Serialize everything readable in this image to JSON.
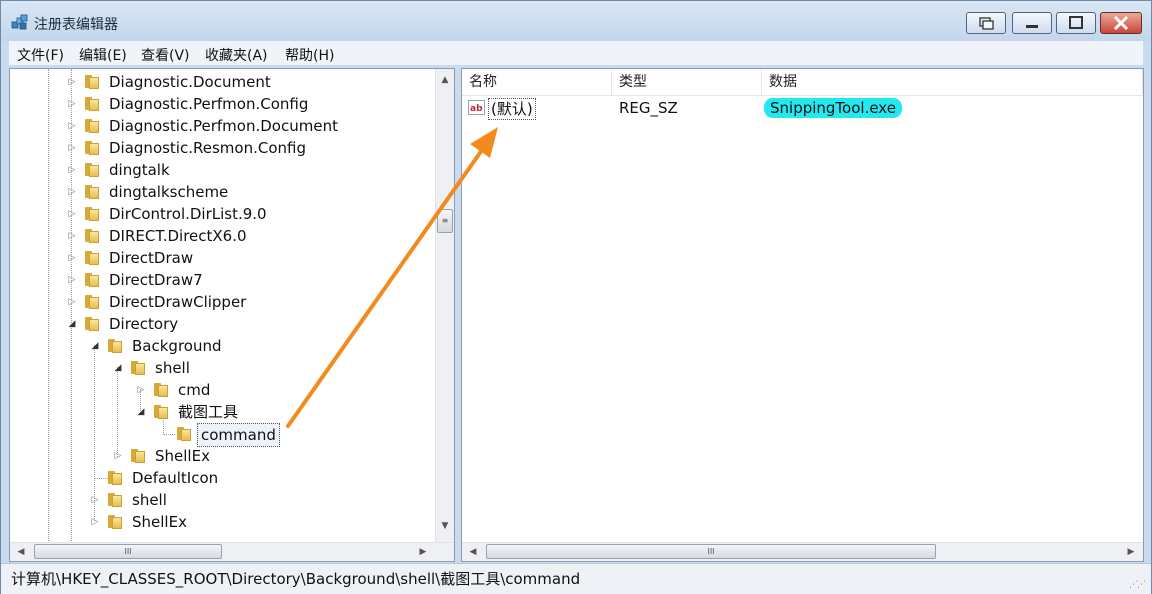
{
  "window": {
    "title": "注册表编辑器"
  },
  "menubar": {
    "items": [
      "文件(F)",
      "编辑(E)",
      "查看(V)",
      "收藏夹(A)",
      "帮助(H)"
    ]
  },
  "tree": {
    "items": [
      {
        "label": "Diagnostic.Document",
        "state": "collapsed"
      },
      {
        "label": "Diagnostic.Perfmon.Config",
        "state": "collapsed"
      },
      {
        "label": "Diagnostic.Perfmon.Document",
        "state": "collapsed"
      },
      {
        "label": "Diagnostic.Resmon.Config",
        "state": "collapsed"
      },
      {
        "label": "dingtalk",
        "state": "collapsed"
      },
      {
        "label": "dingtalkscheme",
        "state": "collapsed"
      },
      {
        "label": "DirControl.DirList.9.0",
        "state": "collapsed"
      },
      {
        "label": "DIRECT.DirectX6.0",
        "state": "collapsed"
      },
      {
        "label": "DirectDraw",
        "state": "collapsed"
      },
      {
        "label": "DirectDraw7",
        "state": "collapsed"
      },
      {
        "label": "DirectDrawClipper",
        "state": "collapsed"
      },
      {
        "label": "Directory",
        "state": "expanded"
      },
      {
        "label": "Background",
        "state": "expanded"
      },
      {
        "label": "shell",
        "state": "expanded"
      },
      {
        "label": "cmd",
        "state": "collapsed"
      },
      {
        "label": "截图工具",
        "state": "expanded"
      },
      {
        "label": "command",
        "state": "leaf",
        "selected": true
      },
      {
        "label": "ShellEx",
        "state": "collapsed"
      },
      {
        "label": "DefaultIcon",
        "state": "leaf"
      },
      {
        "label": "shell",
        "state": "collapsed"
      },
      {
        "label": "ShellEx",
        "state": "collapsed"
      }
    ]
  },
  "list": {
    "headers": {
      "name": "名称",
      "type": "类型",
      "data": "数据"
    },
    "rows": [
      {
        "name": "(默认)",
        "type": "REG_SZ",
        "data": "SnippingTool.exe",
        "icon": "string-value-icon"
      }
    ],
    "highlight_color": "#22e8ef"
  },
  "scrollbar": {
    "grip": "III"
  },
  "status": {
    "path": "计算机\\HKEY_CLASSES_ROOT\\Directory\\Background\\shell\\截图工具\\command"
  },
  "annotation": {
    "arrow_color": "#f38a1d"
  }
}
